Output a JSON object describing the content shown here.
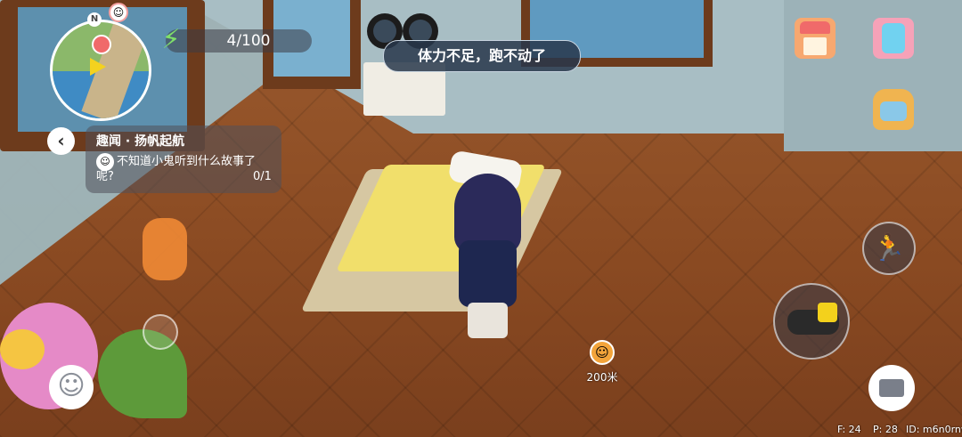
{
  "hud": {
    "stamina": {
      "value": "4/100",
      "icon": "lightning-icon",
      "color": "#7fe06a"
    },
    "toast": "体力不足，跑不动了",
    "minimap": {
      "north": "N",
      "avatar_icon": "player-avatar-icon"
    }
  },
  "quest": {
    "title": "趣闻 · 扬帆起航",
    "desc_line1": "不知道小鬼听到什么故事了",
    "desc_line2": "呢?",
    "progress": "0/1"
  },
  "npc_marker": {
    "icon": "npc-avatar-icon",
    "distance": "200米"
  },
  "debug": {
    "fps": "F: 24",
    "ping": "P: 28",
    "id": "ID: m6n0rnw"
  },
  "icons": {
    "shop": "house-shop-icon",
    "phone": "phone-icon",
    "bag": "backpack-icon",
    "jump": "jump-icon",
    "tool": "binoculars-icon",
    "toolbox": "toolbox-icon",
    "emote": "smiley-icon"
  },
  "colors": {
    "toast_bg": "#28374b",
    "accent_stamina": "#7fe06a"
  }
}
